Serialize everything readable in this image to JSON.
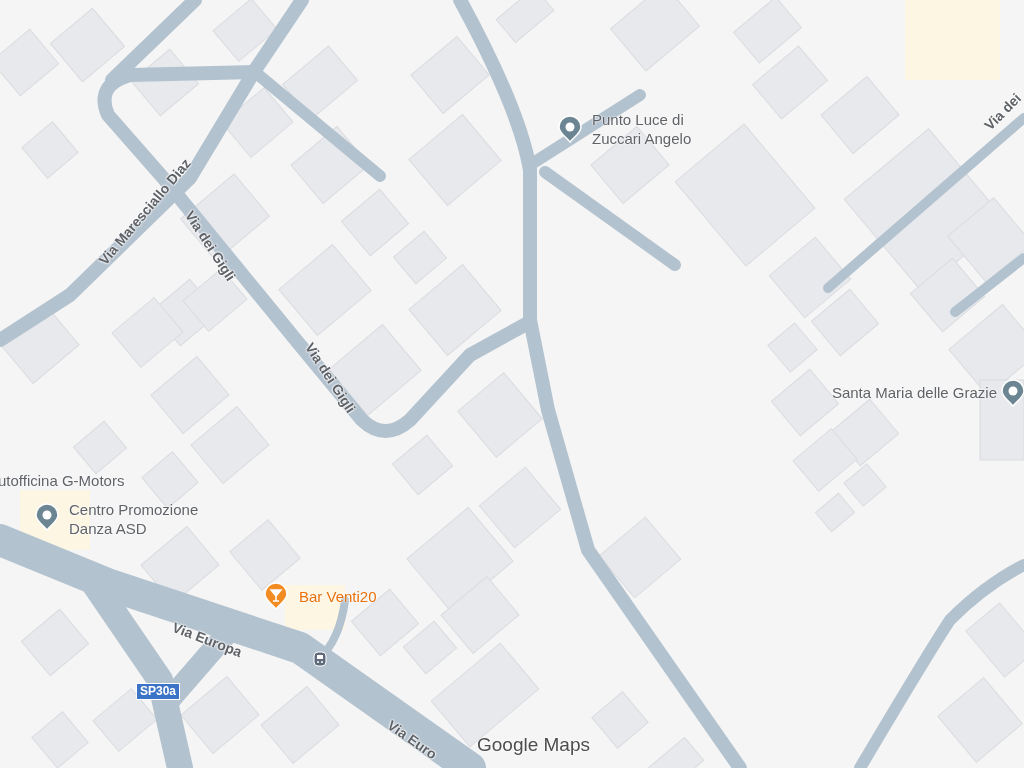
{
  "road_labels": [
    {
      "name": "Via Maresciallo Diaz"
    },
    {
      "name": "Via dei Gigli"
    },
    {
      "name": "Via dei Gigli"
    },
    {
      "name": "Via Europa"
    },
    {
      "name": "Via Euro"
    },
    {
      "name": "Via dei"
    }
  ],
  "places": [
    {
      "name": "Punto Luce di Zuccari Angelo",
      "kind": "generic"
    },
    {
      "name": "Santa Maria delle Grazie",
      "kind": "generic"
    },
    {
      "name": "utofficina G-Motors",
      "kind": "label"
    },
    {
      "name": "Centro Promozione Danza ASD",
      "kind": "generic"
    },
    {
      "name": "Bar Venti20",
      "kind": "bar"
    }
  ],
  "route_shields": [
    {
      "label": "SP30a"
    }
  ],
  "logo": {
    "text": "Google Maps"
  }
}
